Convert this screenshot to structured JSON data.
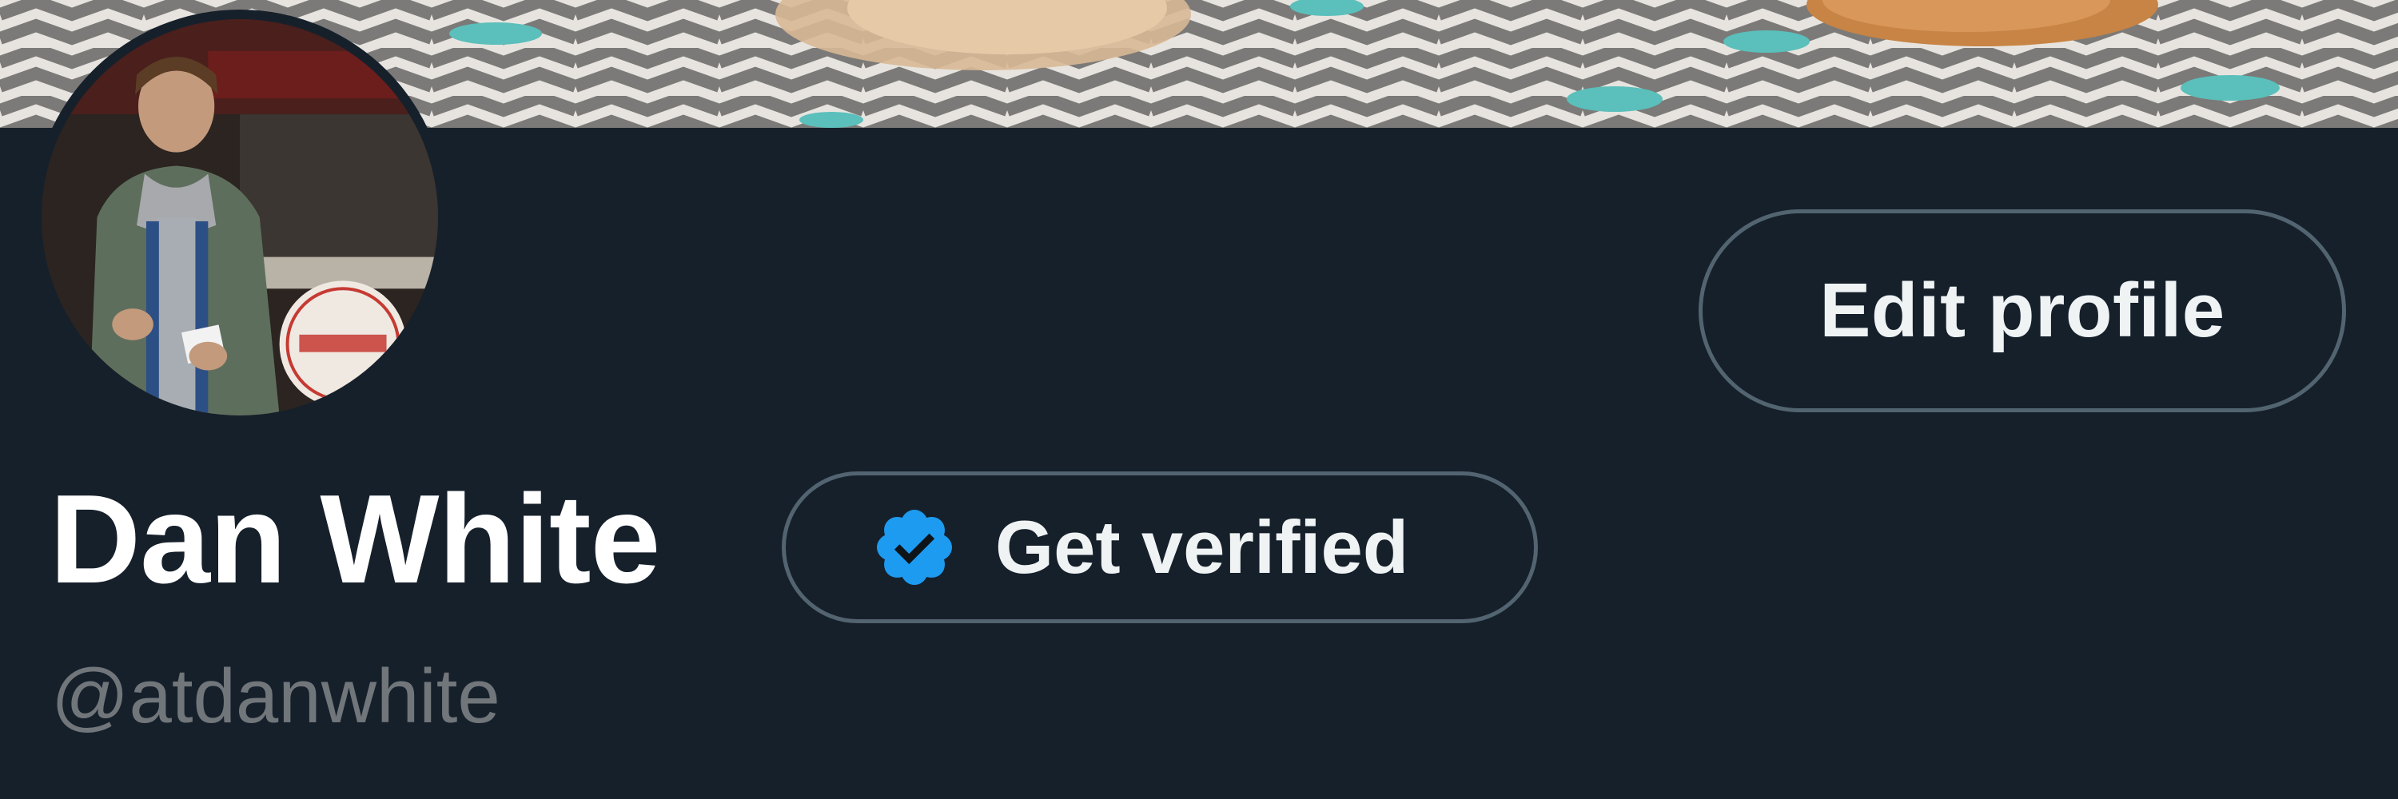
{
  "profile": {
    "display_name": "Dan White",
    "handle": "@atdanwhite"
  },
  "actions": {
    "edit_profile_label": "Edit profile",
    "get_verified_label": "Get verified"
  },
  "icons": {
    "verified_badge": "verified-badge-icon"
  },
  "colors": {
    "background": "#16202b",
    "button_border": "#536471",
    "verified_blue": "#1d9bf0",
    "handle_gray": "#71767b"
  }
}
